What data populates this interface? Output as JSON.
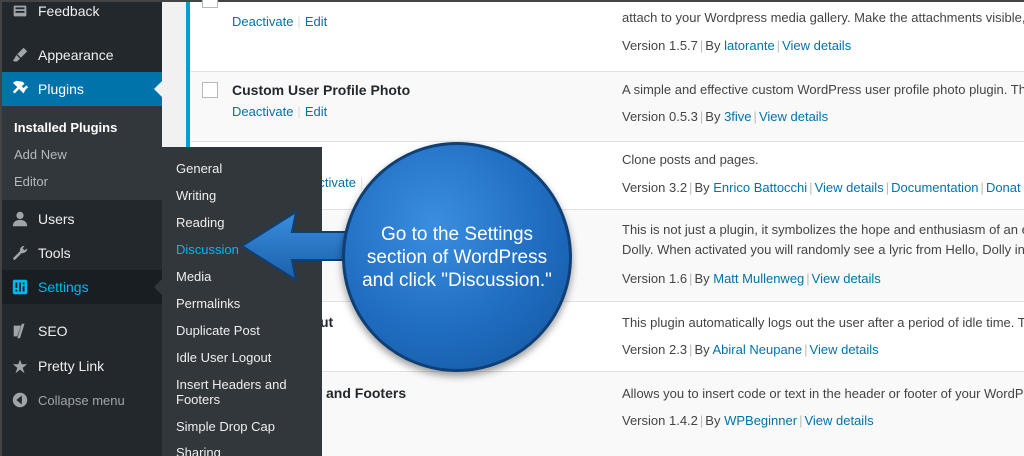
{
  "sidebar": {
    "top": [
      {
        "label": "Feedback",
        "icon": "feedback-icon"
      },
      {
        "label": "Appearance",
        "icon": "paintbrush-icon"
      },
      {
        "label": "Plugins",
        "icon": "plugin-icon"
      }
    ],
    "plugins_submenu": [
      "Installed Plugins",
      "Add New",
      "Editor"
    ],
    "bottom": [
      {
        "label": "Users",
        "icon": "users-icon"
      },
      {
        "label": "Tools",
        "icon": "wrench-icon"
      },
      {
        "label": "Settings",
        "icon": "settings-icon"
      },
      {
        "label": "SEO",
        "icon": "yoast-seo-icon"
      },
      {
        "label": "Pretty Link",
        "icon": "star-icon"
      },
      {
        "label": "Collapse menu",
        "icon": "collapse-icon"
      }
    ]
  },
  "settings_flyout": [
    "General",
    "Writing",
    "Reading",
    "Discussion",
    "Media",
    "Permalinks",
    "Duplicate Post",
    "Idle User Logout",
    "Insert Headers and Footers",
    "Simple Drop Cap",
    "Sharing"
  ],
  "plugins": [
    {
      "name": "",
      "actions": [
        "Deactivate",
        "Edit"
      ],
      "desc": "attach to your Wordpress media gallery. Make the attachments visible,",
      "version": "Version 1.5.7",
      "by": "By",
      "author": "latorante",
      "links": [
        "View details"
      ]
    },
    {
      "name": "Custom User Profile Photo",
      "actions": [
        "Deactivate",
        "Edit"
      ],
      "desc": "A simple and effective custom WordPress user profile photo plugin. Th",
      "version": "Version 0.5.3",
      "by": "By",
      "author": "3five",
      "links": [
        "View details"
      ]
    },
    {
      "name": "",
      "actions": [
        "Deactivate",
        ""
      ],
      "desc": "Clone posts and pages.",
      "version": "Version 3.2",
      "by": "By",
      "author": "Enrico Battocchi",
      "links": [
        "View details",
        "Documentation",
        "Donat"
      ]
    },
    {
      "name": "",
      "actions": [],
      "desc": "This is not just a plugin, it symbolizes the hope and enthusiasm of an e",
      "desc2": "Dolly. When activated you will randomly see a lyric from Hello, Dolly in",
      "version": "Version 1.6",
      "by": "By",
      "author": "Matt Mullenweg",
      "links": [
        "View details"
      ]
    },
    {
      "name": "ut",
      "actions": [],
      "desc": "This plugin automatically logs out the user after a period of idle time. T",
      "version": "Version 2.3",
      "by": "By",
      "author": "Abiral Neupane",
      "links": [
        "View details"
      ]
    },
    {
      "name": "and Footers",
      "actions": [],
      "desc": "Allows you to insert code or text in the header or footer of your WordP",
      "version": "Version 1.4.2",
      "by": "By",
      "author": "WPBeginner",
      "links": [
        "View details"
      ]
    }
  ],
  "callout": {
    "text": "Go to the Settings section of WordPress and click \"Discussion.\""
  },
  "colors": {
    "accent": "#0073aa",
    "sidebar": "#23282d",
    "callout": "#1f6cc0",
    "arrow": "#1f6cc0"
  }
}
